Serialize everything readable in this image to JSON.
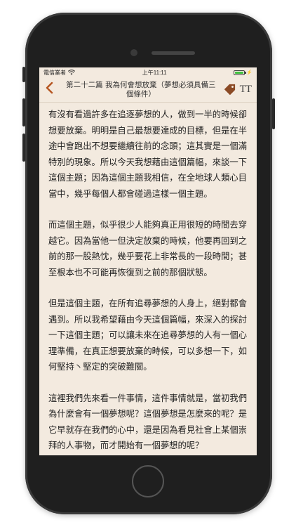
{
  "status_bar": {
    "carrier": "電信業者",
    "time": "上午11:11",
    "battery_level": 1.0
  },
  "navbar": {
    "back_icon": "chevron-left-icon",
    "title": "第二十二篇 我為何會想放棄（夢想必須具備三個條件）",
    "tag_icon": "tag-icon",
    "font_size_label": "TT"
  },
  "colors": {
    "accent": "#b5541f",
    "background": "#f3eadf",
    "text": "#222222"
  },
  "article": {
    "paragraphs": [
      "有沒有看過許多在追逐夢想的人，做到一半的時候卻想要放棄。明明是自己最想要達成的目標，但是在半途中會跑出不想要繼續往前的念頭；這其實是一個滿特別的現象。所以今天我想藉由這個篇幅，來談一下這個主題；因為這個主題我相信，在全地球人類心目當中，幾乎每個人都會碰過這樣一個主題。",
      "而這個主題，似乎很少人能夠真正用很短的時間去穿越它。因為當他一但決定放棄的時候，他要再回到之前的那一股熱忱，幾乎要花上非常長的一段時間；甚至根本也不可能再恢復到之前的那個狀態。",
      "但是這個主題，在所有追尋夢想的人身上，絕對都會遇到。所以我希望藉由今天這個篇幅，來深入的探討一下這個主題；可以讓未來在追尋夢想的人有一個心理準備，在真正想要放棄的時候，可以多想一下，如何堅持丶堅定的突破難關。",
      "這裡我們先來看一件事情，這件事情就是，當初我們為什麼會有一個夢想呢？這個夢想是怎麼來的呢？是它早就存在我們的心中，還是因為看見社會上某個崇拜的人事物，而才開始有一個夢想的呢？"
    ]
  }
}
